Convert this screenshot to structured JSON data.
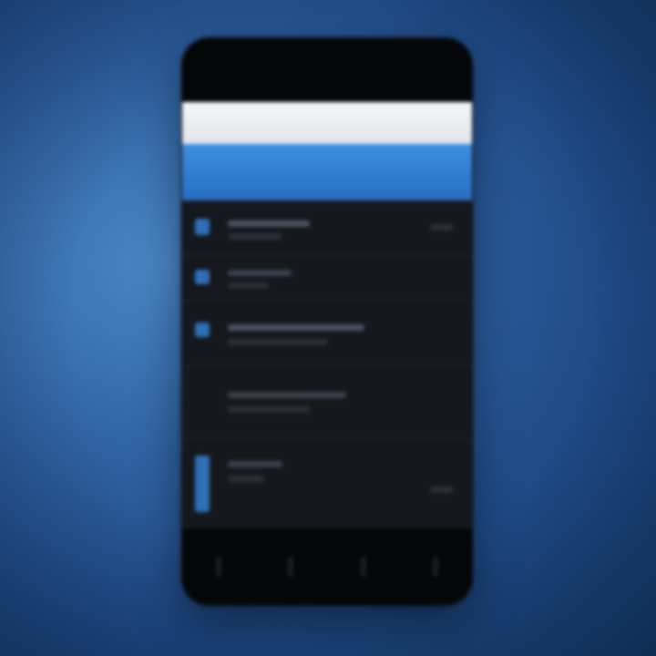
{
  "scene": {
    "background_colors": [
      "#4a86c6",
      "#2f62a3",
      "#1f4a86",
      "#153968"
    ],
    "accent_color": "#3d8fe0",
    "text_blurred": true
  },
  "phone": {
    "status_bar_color": "#050608",
    "header_bar_color": "#f4f6f8",
    "title_bar_color": "#3d8fe0",
    "content_background": "#15181d",
    "list_rows": [
      {
        "icon": "item-icon",
        "has_marker": true
      },
      {
        "icon": "item-icon",
        "has_marker": true
      },
      {
        "icon": "item-icon",
        "has_marker": true
      },
      {
        "icon": "item-icon",
        "has_marker": false
      },
      {
        "icon": "item-icon",
        "has_marker": true
      }
    ],
    "bottom_nav": [
      {
        "icon": "home-icon"
      },
      {
        "icon": "list-icon"
      },
      {
        "icon": "search-icon"
      },
      {
        "icon": "settings-icon"
      }
    ]
  }
}
